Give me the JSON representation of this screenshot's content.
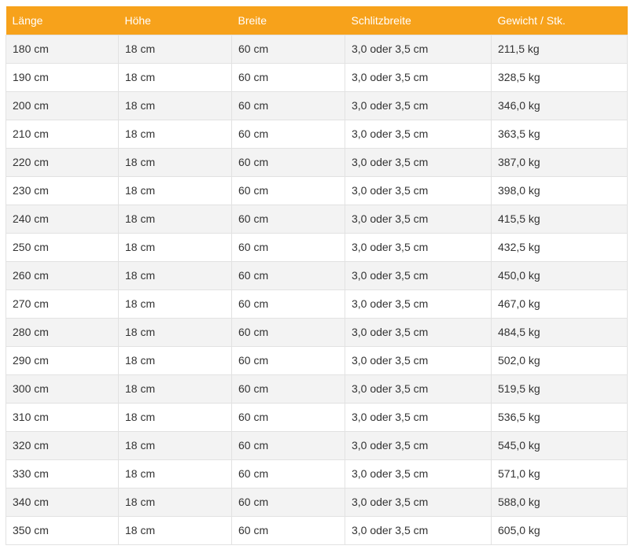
{
  "table": {
    "headers": [
      "Länge",
      "Höhe",
      "Breite",
      "Schlitzbreite",
      "Gewicht / Stk."
    ],
    "rows": [
      [
        "180 cm",
        "18 cm",
        "60 cm",
        "3,0 oder 3,5 cm",
        "211,5 kg"
      ],
      [
        "190 cm",
        "18 cm",
        "60 cm",
        "3,0 oder 3,5 cm",
        "328,5 kg"
      ],
      [
        "200 cm",
        "18 cm",
        "60 cm",
        "3,0 oder 3,5 cm",
        "346,0 kg"
      ],
      [
        "210 cm",
        "18 cm",
        "60 cm",
        "3,0 oder 3,5 cm",
        "363,5 kg"
      ],
      [
        "220 cm",
        "18 cm",
        "60 cm",
        "3,0 oder 3,5 cm",
        "387,0 kg"
      ],
      [
        "230 cm",
        "18 cm",
        "60 cm",
        "3,0 oder 3,5 cm",
        "398,0 kg"
      ],
      [
        "240 cm",
        "18 cm",
        "60 cm",
        "3,0 oder 3,5 cm",
        "415,5 kg"
      ],
      [
        "250 cm",
        "18 cm",
        "60 cm",
        "3,0 oder 3,5 cm",
        "432,5 kg"
      ],
      [
        "260 cm",
        "18 cm",
        "60 cm",
        "3,0 oder 3,5 cm",
        "450,0 kg"
      ],
      [
        "270 cm",
        "18 cm",
        "60 cm",
        "3,0 oder 3,5 cm",
        "467,0 kg"
      ],
      [
        "280 cm",
        "18 cm",
        "60 cm",
        "3,0 oder 3,5 cm",
        "484,5 kg"
      ],
      [
        "290 cm",
        "18 cm",
        "60 cm",
        "3,0 oder 3,5 cm",
        "502,0 kg"
      ],
      [
        "300 cm",
        "18 cm",
        "60 cm",
        "3,0 oder 3,5 cm",
        "519,5 kg"
      ],
      [
        "310 cm",
        "18 cm",
        "60 cm",
        "3,0 oder 3,5 cm",
        "536,5 kg"
      ],
      [
        "320 cm",
        "18 cm",
        "60 cm",
        "3,0 oder 3,5 cm",
        "545,0 kg"
      ],
      [
        "330 cm",
        "18 cm",
        "60 cm",
        "3,0 oder 3,5 cm",
        "571,0 kg"
      ],
      [
        "340 cm",
        "18 cm",
        "60 cm",
        "3,0 oder 3,5 cm",
        "588,0 kg"
      ],
      [
        "350 cm",
        "18 cm",
        "60 cm",
        "3,0 oder 3,5 cm",
        "605,0 kg"
      ]
    ]
  },
  "colors": {
    "header_background": "#f7a21b",
    "header_text": "#ffffff",
    "row_odd": "#f3f3f3",
    "row_even": "#ffffff",
    "border": "#e2e2e2",
    "text": "#333333"
  }
}
